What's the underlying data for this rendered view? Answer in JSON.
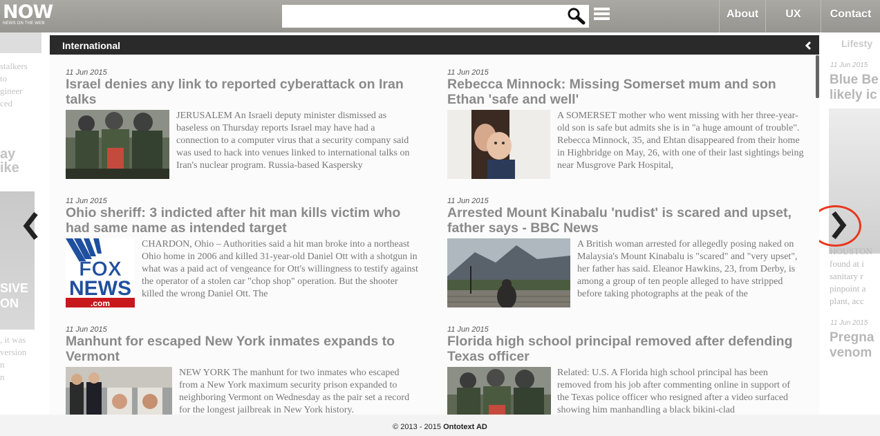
{
  "header": {
    "logo_main": "NOW",
    "logo_sub": "NEWS ON THE WEB",
    "search_value": "",
    "nav": {
      "about": "About",
      "ux_brief": "UX Brief",
      "contact": "Contact"
    }
  },
  "left_panel": {
    "lines": [
      "stalkers",
      "to",
      "gineer",
      "ced"
    ],
    "big": [
      "ay",
      "ike"
    ],
    "img_text": [
      "SIVE",
      "ON"
    ],
    "lower": [
      ", it was",
      "version",
      "n",
      "n"
    ]
  },
  "right_panel": {
    "heading": "Lifesty",
    "article1_date": "11 Jun 2015",
    "article1_title": [
      "Blue Be",
      "likely ic"
    ],
    "snip": [
      "HOUSTON",
      "found at i",
      "sanitary r",
      "pinpoint a",
      "plant, acc"
    ],
    "article2_date": "11 Jun 2015",
    "article2_title": [
      "Pregna",
      "venom"
    ]
  },
  "section": {
    "title": "International"
  },
  "articles": [
    {
      "date": "11 Jun 2015",
      "title": "Israel denies any link to reported cyberattack on Iran talks",
      "snippet": "JERUSALEM An Israeli deputy minister dismissed as baseless on Thursday reports Israel may have had a connection to a computer virus that a security company said was used to hack into venues linked to international talks on Iran's nuclear program. Russia-based Kaspersky"
    },
    {
      "date": "11 Jun 2015",
      "title": "Rebecca Minnock: Missing Somerset mum and son Ethan 'safe and well'",
      "snippet": "A SOMERSET mother who went missing with her three-year-old son is safe but admits she is in \"a huge amount of trouble\". Rebecca Minnock, 35, and Ehtan disappeared from their home in Highbridge on May, 26, with one of their last sightings being near Musgrove Park Hospital,"
    },
    {
      "date": "11 Jun 2015",
      "title": "Ohio sheriff: 3 indicted after hit man kills victim who had same name as intended target",
      "snippet": "CHARDON, Ohio –  Authorities said a hit man broke into a northeast Ohio home in 2006 and killed 31-year-old Daniel Ott with a shotgun in what was a paid act of vengeance for Ott's willingness to testify against the operator of a stolen car \"chop shop\" operation. But the shooter killed the wrong Daniel Ott. The"
    },
    {
      "date": "11 Jun 2015",
      "title": "Arrested Mount Kinabalu 'nudist' is scared and upset, father says - BBC News",
      "snippet": "A British woman arrested for allegedly posing naked on Malaysia's Mount Kinabalu is \"scared\" and \"very upset\", her father has said. Eleanor Hawkins, 23, from Derby, is among a group of ten people alleged to have stripped before taking photographs at the peak of the"
    },
    {
      "date": "11 Jun 2015",
      "title": "Manhunt for escaped New York inmates expands to Vermont",
      "snippet": "NEW YORK The manhunt for two inmates who escaped from a New York maximum security prison expanded to neighboring Vermont on Wednesday as the pair set a record for the longest jailbreak in New York history."
    },
    {
      "date": "11 Jun 2015",
      "title": "Florida high school principal removed after defending Texas officer",
      "snippet": "Related: U.S. A Florida high school principal has been removed from his job after commenting online in support of the Texas police officer who resigned after a video surfaced showing him manhandling a black bikini-clad"
    }
  ],
  "fox_logo": {
    "line1": "FOX",
    "line2": "NEWS",
    "line3": ".com"
  },
  "footer": {
    "prefix": "© 2013 - 2015",
    "company": "Ontotext AD"
  }
}
